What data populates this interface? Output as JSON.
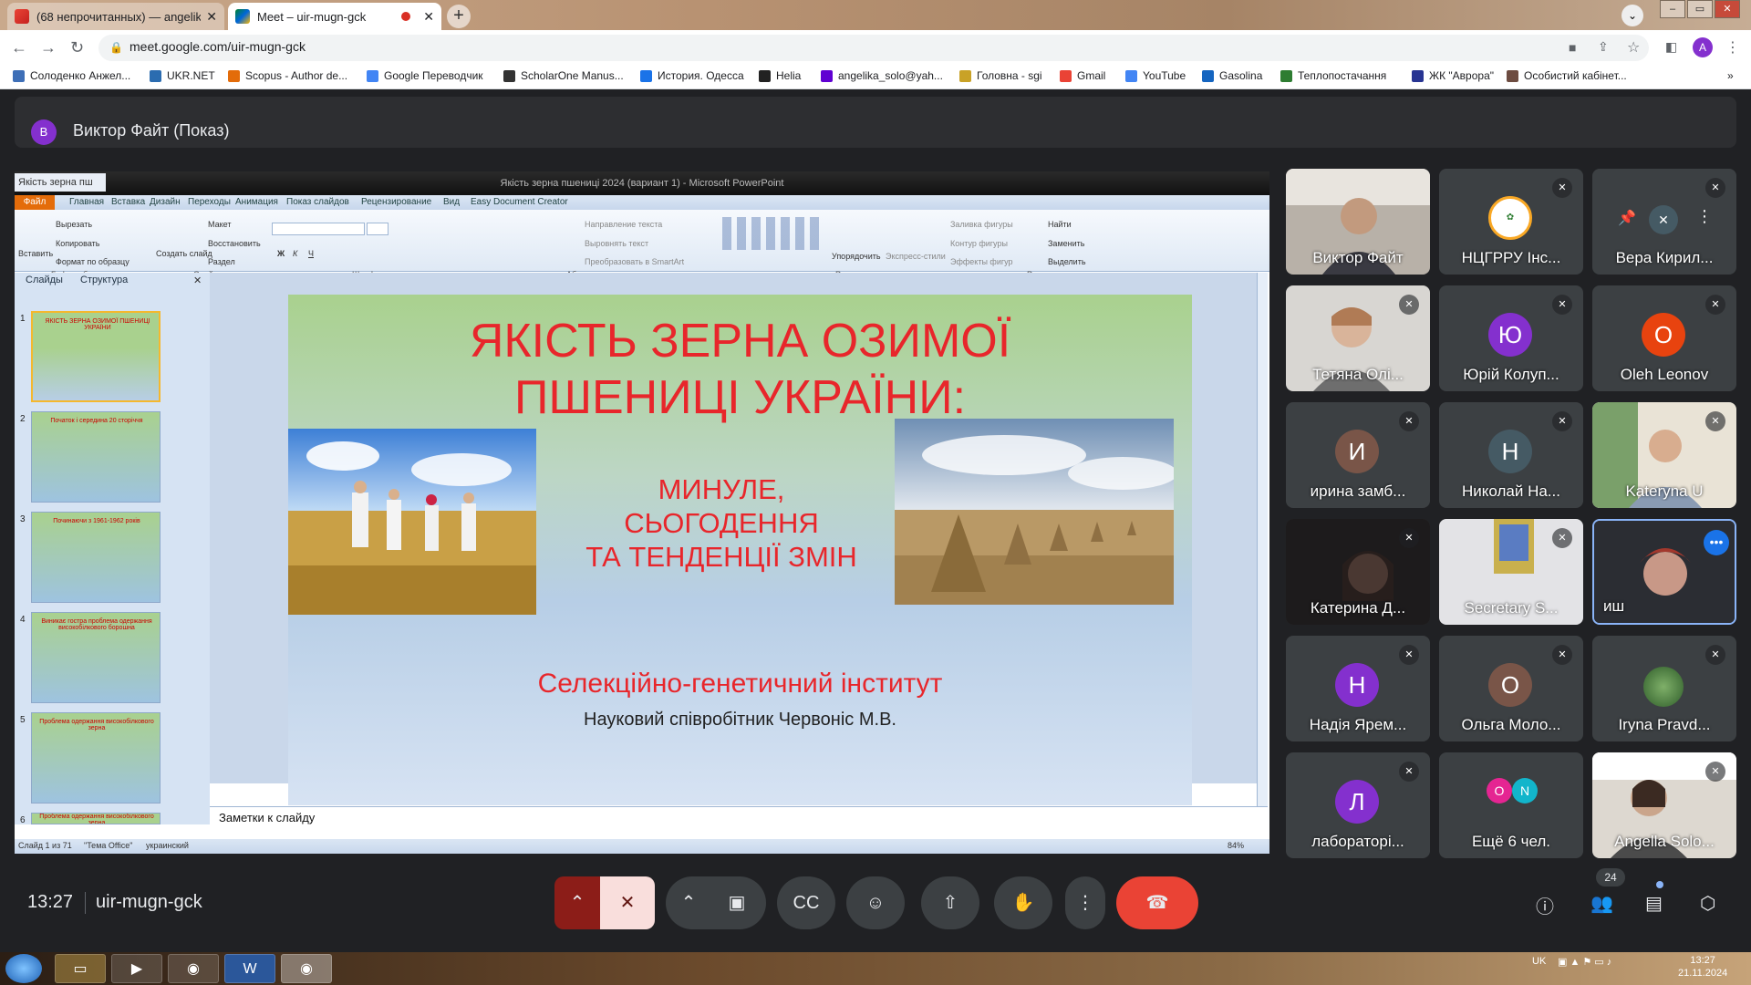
{
  "browser": {
    "tabs": [
      {
        "label": "(68 непрочитанных) — angelika",
        "icon": "gmail-icon",
        "active": false
      },
      {
        "label": "Meet – uir-mugn-gck",
        "icon": "meet-icon",
        "active": true
      }
    ],
    "url": "meet.google.com/uir-mugn-gck",
    "profile_initial": "A",
    "bookmarks": [
      "Солоденко Анжел...",
      "UKR.NET",
      "Scopus - Author de...",
      "Google Переводчик",
      "ScholarOne Manus...",
      "История. Одесса",
      "Helia",
      "angelika_solo@yah...",
      "Головна - sgi",
      "Gmail",
      "YouTube",
      "Gasolina",
      "Теплопостачання",
      "ЖК \"Аврора\"",
      "Особистий кабінет..."
    ]
  },
  "presenter": {
    "initial": "В",
    "label": "Виктор Файт (Показ)"
  },
  "powerpoint": {
    "tab_label": "Якість зерна пш",
    "window_title": "Якість зерна пшениці 2024 (вариант 1) - Microsoft PowerPoint",
    "file_menu": "Файл",
    "menu": [
      "Главная",
      "Вставка",
      "Дизайн",
      "Переходы",
      "Анимация",
      "Показ слайдов",
      "Рецензирование",
      "Вид",
      "Easy Document Creator"
    ],
    "ribbon": {
      "paste": "Вставить",
      "cut": "Вырезать",
      "copy": "Копировать",
      "format_painter": "Формат по образцу",
      "clipboard": "Буфер обмена",
      "new_slide": "Создать слайд",
      "layout": "Макет",
      "reset": "Восстановить",
      "section": "Раздел",
      "slides": "Слайды",
      "font": "Шрифт",
      "text_direction": "Направление текста",
      "align_text": "Выровнять текст",
      "smartart": "Преобразовать в SmartArt",
      "paragraph": "Абзац",
      "arrange": "Упорядочить",
      "quick_styles": "Экспресс-стили",
      "shape_fill": "Заливка фигуры",
      "shape_outline": "Контур фигуры",
      "shape_effects": "Эффекты фигур",
      "drawing": "Рисование",
      "find": "Найти",
      "replace": "Заменить",
      "select": "Выделить",
      "editing": "Редактирование"
    },
    "panel_tabs": [
      "Слайды",
      "Структура"
    ],
    "thumbs": [
      {
        "num": "1",
        "text": "ЯКІСТЬ ЗЕРНА ОЗИМОЇ ПШЕНИЦІ УКРАЇНИ"
      },
      {
        "num": "2",
        "text": "Початок і середина 20 сторіччя"
      },
      {
        "num": "3",
        "text": "Починаючи з 1961-1962 років"
      },
      {
        "num": "4",
        "text": "Виникає гостра проблема одержання високобілкового борошна"
      },
      {
        "num": "5",
        "text": "Проблема одержання високобілкового зерна"
      },
      {
        "num": "6",
        "text": "Проблема одержання високобілкового зерна"
      }
    ],
    "slide": {
      "title_line1": "ЯКІСТЬ ЗЕРНА ОЗИМОЇ",
      "title_line2": "ПШЕНИЦІ УКРАЇНИ:",
      "sub1": "МИНУЛЕ,",
      "sub2": "СЬОГОДЕННЯ",
      "sub3": "ТА ТЕНДЕНЦІЇ ЗМІН",
      "institute": "Селекційно-генетичний інститут",
      "author": "Науковий співробітник Червоніс М.В."
    },
    "notes": "Заметки к слайду",
    "status": {
      "slide": "Слайд 1 из 71",
      "theme": "\"Тема Office\"",
      "lang": "украинский",
      "zoom": "84%"
    }
  },
  "participants": [
    {
      "name": "Виктор Файт",
      "type": "video"
    },
    {
      "name": "НЦГРРУ Інс...",
      "type": "logo"
    },
    {
      "name": "Вера Кирил...",
      "type": "hover"
    },
    {
      "name": "Тетяна Олі...",
      "type": "video"
    },
    {
      "name": "Юрій Колуп...",
      "type": "avatar",
      "initial": "Ю",
      "color": "#8430ce"
    },
    {
      "name": "Oleh Leonov",
      "type": "avatar",
      "initial": "O",
      "color": "#e8430f"
    },
    {
      "name": "ирина замб...",
      "type": "avatar",
      "initial": "И",
      "color": "#795548"
    },
    {
      "name": "Николай На...",
      "type": "avatar",
      "initial": "Н",
      "color": "#455a64"
    },
    {
      "name": "Kateryna U",
      "type": "video"
    },
    {
      "name": "Катерина Д...",
      "type": "video"
    },
    {
      "name": "Secretary S...",
      "type": "video"
    },
    {
      "name": "иш",
      "type": "video"
    },
    {
      "name": "Надія Ярем...",
      "type": "avatar",
      "initial": "Н",
      "color": "#8430ce"
    },
    {
      "name": "Ольга Моло...",
      "type": "avatar",
      "initial": "О",
      "color": "#795548"
    },
    {
      "name": "Iryna Pravd...",
      "type": "photo"
    },
    {
      "name": "лабораторі...",
      "type": "avatar",
      "initial": "Л",
      "color": "#8430ce"
    },
    {
      "name": "Ещё 6 чел.",
      "type": "more",
      "initials": [
        "O",
        "N"
      ]
    },
    {
      "name": "Angella Solo...",
      "type": "video"
    }
  ],
  "meeting": {
    "time": "13:27",
    "code": "uir-mugn-gck",
    "people_count": "24"
  },
  "taskbar": {
    "lang": "UK",
    "time": "13:27",
    "date": "21.11.2024"
  }
}
